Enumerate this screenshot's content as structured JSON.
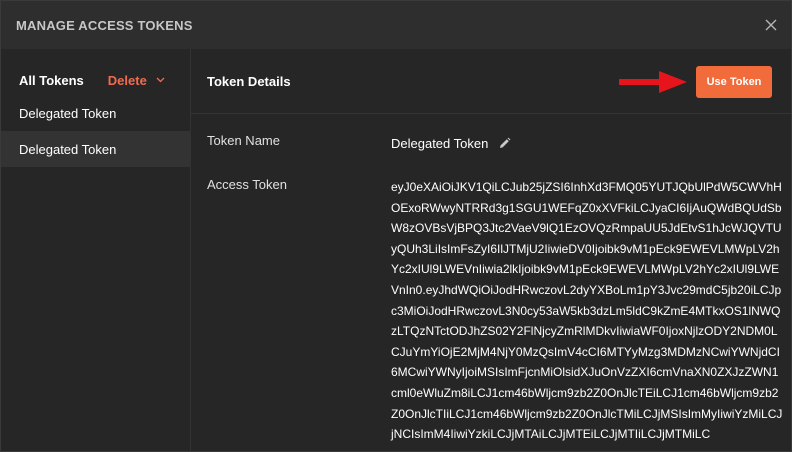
{
  "modal": {
    "title": "MANAGE ACCESS TOKENS"
  },
  "sidebar": {
    "all_tokens_label": "All Tokens",
    "delete_label": "Delete",
    "items": [
      {
        "label": "Delegated Token",
        "active": false
      },
      {
        "label": "Delegated Token",
        "active": true
      }
    ]
  },
  "detail": {
    "title": "Token Details",
    "use_token_label": "Use Token",
    "token_name_label": "Token Name",
    "token_name_value": "Delegated Token",
    "access_token_label": "Access Token",
    "access_token_value": "eyJ0eXAiOiJKV1QiLCJub25jZSI6InhXd3FMQ05YUTJQbUlPdW5CWVhHOExoRWwyNTRRd3g1SGU1WEFqZ0xXVFkiLCJyaCI6IjAuQWdBQUdSbW8zOVBsVjBPQ3Jtc2VaeV9lQ1EzOVQzRmpaUU5JdEtvS1hJcWJQVTUyQUh3LiIsImFsZyI6IlJTMjU2IiwieDV0Ijoibk9vM1pEck9EWEVLMWpLV2hYc2xIUl9LWEVnIiwia2lkIjoibk9vM1pEck9EWEVLMWpLV2hYc2xIUl9LWEVnIn0.eyJhdWQiOiJodHRwczovL2dyYXBoLm1pY3Jvc29mdC5jb20iLCJpc3MiOiJodHRwczovL3N0cy53aW5kb3dzLm5ldC9kZmE4MTkxOS1lNWQzLTQzNTctODJhZS02Y2FlNjcyZmRlMDkvIiwiaWF0IjoxNjlzODY2NDM0LCJuYmYiOjE2MjM4NjY0MzQsImV4cCI6MTYyMzg3MDMzNCwiYWNjdCI6MCwiYWNyIjoiMSIsImFjcnMiOlsidXJuOnVzZXI6cmVnaXN0ZXJzZWN1cml0eWluZm8iLCJ1cm46bWljcm9zb2Z0OnJlcTEiLCJ1cm46bWljcm9zb2Z0OnJlcTIiLCJ1cm46bWljcm9zb2Z0OnJlcTMiLCJjMSIsImMyIiwiYzMiLCJjNCIsImM4IiwiYzkiLCJjMTAiLCJjMTEiLCJjMTIiLCJjMTMiLC"
  },
  "icons": {
    "close": "close-icon",
    "chevron": "chevron-down-icon",
    "edit": "pencil-icon",
    "arrow": "red-arrow-icon"
  },
  "colors": {
    "accent": "#f26b3a",
    "delete": "#f26b4f",
    "arrow": "#e8141c",
    "background": "#262626",
    "header": "#2e2e2e",
    "selected_item": "#333333"
  }
}
